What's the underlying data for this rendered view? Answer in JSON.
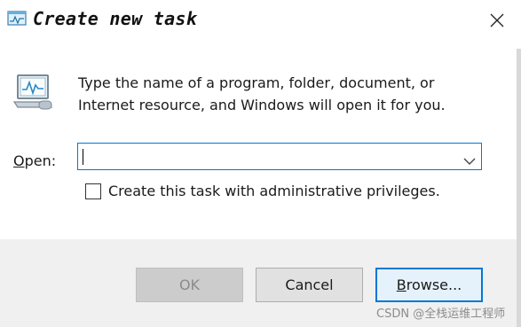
{
  "window": {
    "title": "Create new task",
    "close_icon": "close-icon"
  },
  "description": {
    "line1": "Type the name of a program, folder, document, or",
    "line2": "Internet resource, and Windows will open it for you."
  },
  "open_field": {
    "label_accel": "O",
    "label_rest": "pen:",
    "value": "",
    "placeholder": ""
  },
  "admin_checkbox": {
    "label": "Create this task with administrative privileges.",
    "checked": false
  },
  "buttons": {
    "ok": "OK",
    "cancel": "Cancel",
    "browse_accel": "B",
    "browse_rest": "rowse..."
  },
  "watermark": "CSDN @全栈运维工程师",
  "colors": {
    "accent": "#0078d7",
    "footer_bg": "#f0f0f0",
    "disabled_button": "#cccccc"
  }
}
